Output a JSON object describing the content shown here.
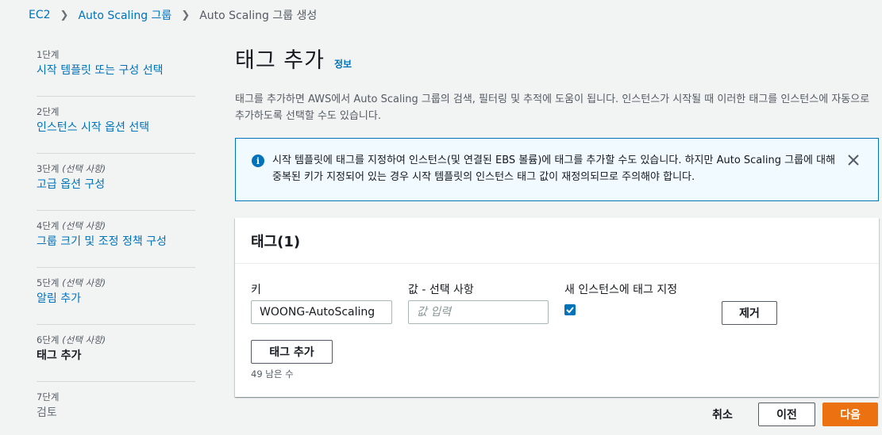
{
  "breadcrumb": {
    "items": [
      "EC2",
      "Auto Scaling 그룹",
      "Auto Scaling 그룹 생성"
    ]
  },
  "steps": [
    {
      "num": "1단계",
      "optional": "",
      "title": "시작 템플릿 또는 구성 선택"
    },
    {
      "num": "2단계",
      "optional": "",
      "title": "인스턴스 시작 옵션 선택"
    },
    {
      "num": "3단계",
      "optional": "(선택 사항)",
      "title": "고급 옵션 구성"
    },
    {
      "num": "4단계",
      "optional": "(선택 사항)",
      "title": "그룹 크기 및 조정 정책 구성"
    },
    {
      "num": "5단계",
      "optional": "(선택 사항)",
      "title": "알림 추가"
    },
    {
      "num": "6단계",
      "optional": "(선택 사항)",
      "title": "태그 추가"
    },
    {
      "num": "7단계",
      "optional": "",
      "title": "검토"
    }
  ],
  "page": {
    "title": "태그 추가",
    "info_link": "정보",
    "description": "태그를 추가하면 AWS에서 Auto Scaling 그룹의 검색, 필터링 및 추적에 도움이 됩니다. 인스턴스가 시작될 때 이러한 태그를 인스턴스에 자동으로 추가하도록 선택할 수도 있습니다."
  },
  "alert": {
    "text": "시작 템플릿에 태그를 지정하여 인스턴스(및 연결된 EBS 볼륨)에 태그를 추가할 수도 있습니다. 하지만 Auto Scaling 그룹에 대해 중복된 키가 지정되어 있는 경우 시작 템플릿의 인스턴스 태그 값이 재정의되므로 주의해야 합니다."
  },
  "tags_panel": {
    "title": "태그(1)",
    "key_label": "키",
    "value_label": "값 - 선택 사항",
    "propagate_label": "새 인스턴스에 태그 지정",
    "key_value": "WOONG-AutoScaling",
    "value_placeholder": "값 입력",
    "propagate_checked": true,
    "remove_button": "제거",
    "add_tag_button": "태그 추가",
    "remaining": "49 남은 수"
  },
  "footer": {
    "cancel": "취소",
    "previous": "이전",
    "next": "다음"
  },
  "colors": {
    "link": "#0073bb",
    "primary": "#ec7211",
    "alert_bg": "#f1faff"
  }
}
